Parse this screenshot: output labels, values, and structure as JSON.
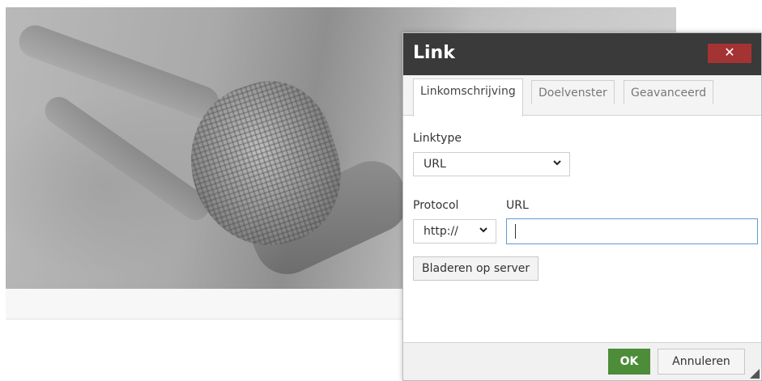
{
  "dialog": {
    "title": "Link",
    "close_icon": "close-icon",
    "close_glyph": "✕",
    "tabs": [
      {
        "label": "Linkomschrijving",
        "active": true
      },
      {
        "label": "Doelvenster",
        "active": false
      },
      {
        "label": "Geavanceerd",
        "active": false
      }
    ],
    "linktype": {
      "label": "Linktype",
      "value": "URL"
    },
    "protocol": {
      "label": "Protocol",
      "value": "http://"
    },
    "url": {
      "label": "URL",
      "value": ""
    },
    "browse_label": "Bladeren op server",
    "ok_label": "OK",
    "cancel_label": "Annuleren"
  },
  "colors": {
    "titlebar": "#3a3a3a",
    "close_button": "#a43334",
    "ok_button": "#4d8c38",
    "input_focus": "#5b9bd5"
  },
  "icons": {
    "select_arrow": "chevron-down-icon",
    "resize": "resize-grip-icon"
  }
}
